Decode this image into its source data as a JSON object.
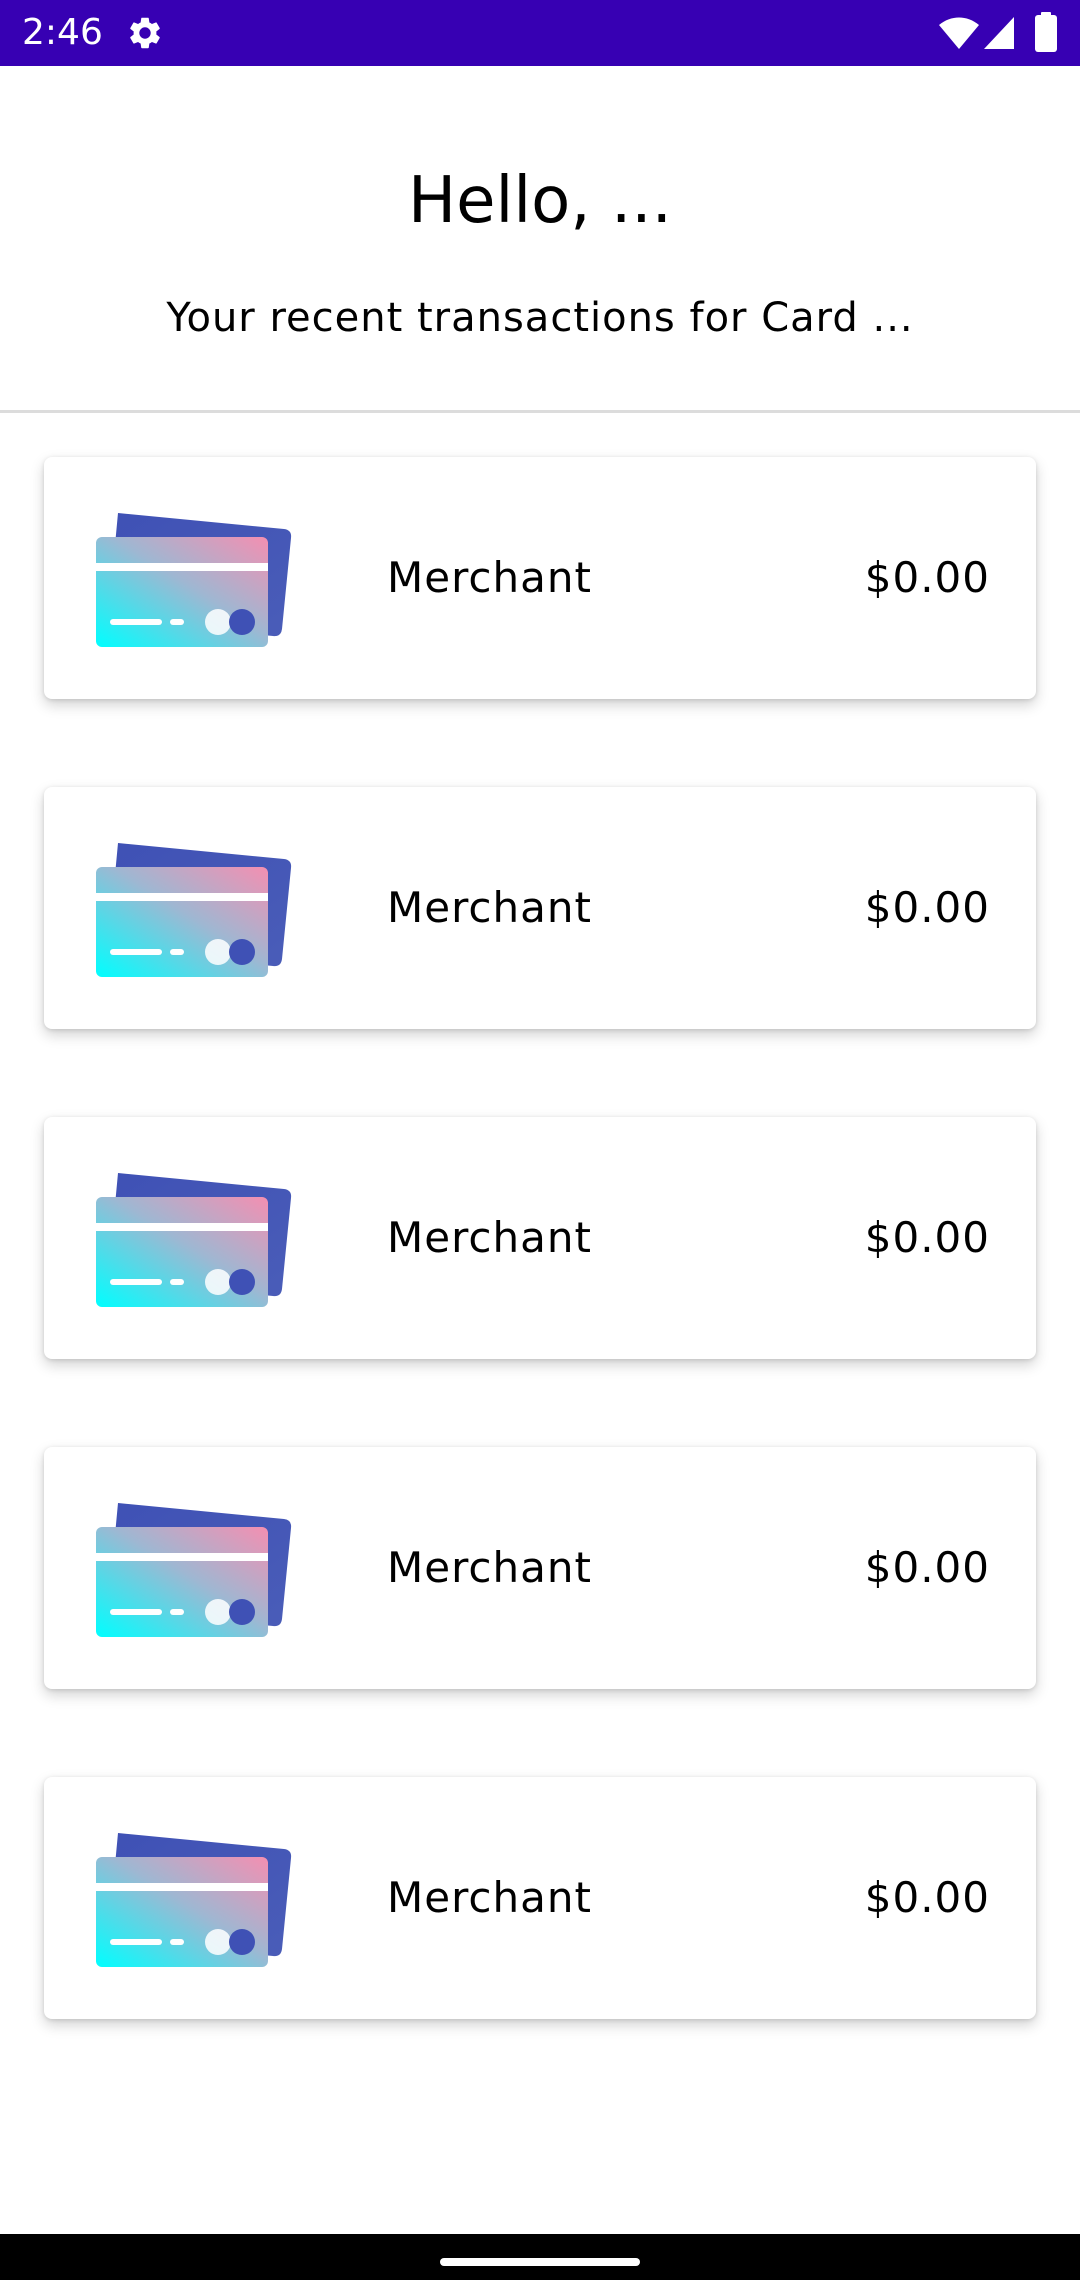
{
  "status_bar": {
    "time": "2:46",
    "background_color": "#3700b3",
    "icons": [
      "gear-icon",
      "wifi-icon",
      "signal-icon",
      "battery-icon"
    ]
  },
  "header": {
    "greeting": "Hello, ...",
    "subtitle": "Your recent transactions for Card ..."
  },
  "transactions": [
    {
      "icon": "credit-card-icon",
      "merchant": "Merchant",
      "amount": "$0.00"
    },
    {
      "icon": "credit-card-icon",
      "merchant": "Merchant",
      "amount": "$0.00"
    },
    {
      "icon": "credit-card-icon",
      "merchant": "Merchant",
      "amount": "$0.00"
    },
    {
      "icon": "credit-card-icon",
      "merchant": "Merchant",
      "amount": "$0.00"
    },
    {
      "icon": "credit-card-icon",
      "merchant": "Merchant",
      "amount": "$0.00"
    }
  ],
  "colors": {
    "card_back": "#3f51b5",
    "card_front_top": "#f48fb1",
    "card_front_bottom": "#00ffff"
  }
}
